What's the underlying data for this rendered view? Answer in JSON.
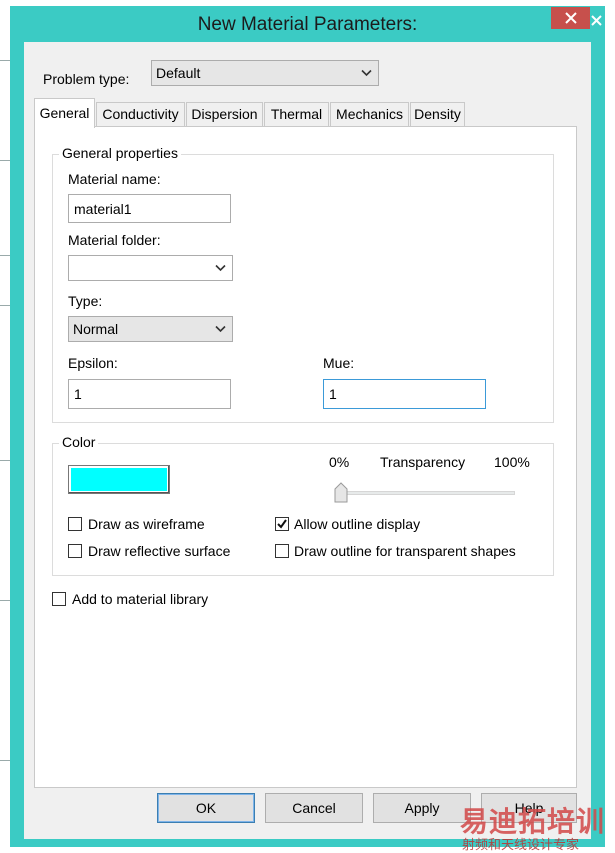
{
  "window": {
    "title": "New Material Parameters:"
  },
  "problem_type": {
    "label": "Problem type:",
    "value": "Default"
  },
  "tabs": [
    {
      "label": "General"
    },
    {
      "label": "Conductivity"
    },
    {
      "label": "Dispersion"
    },
    {
      "label": "Thermal"
    },
    {
      "label": "Mechanics"
    },
    {
      "label": "Density"
    }
  ],
  "general_properties": {
    "title": "General properties",
    "material_name_label": "Material name:",
    "material_name_value": "material1",
    "material_folder_label": "Material folder:",
    "material_folder_value": "",
    "type_label": "Type:",
    "type_value": "Normal",
    "epsilon_label": "Epsilon:",
    "epsilon_value": "1",
    "mue_label": "Mue:",
    "mue_value": "1"
  },
  "color_group": {
    "title": "Color",
    "swatch_color": "#00ffff",
    "transparency_min": "0%",
    "transparency_label": "Transparency",
    "transparency_max": "100%",
    "transparency_value": 0,
    "draw_wireframe_label": "Draw as wireframe",
    "draw_wireframe_checked": false,
    "allow_outline_label": "Allow outline display",
    "allow_outline_checked": true,
    "draw_reflective_label": "Draw reflective surface",
    "draw_reflective_checked": false,
    "draw_outline_transparent_label": "Draw outline for transparent shapes",
    "draw_outline_transparent_checked": false
  },
  "add_to_library": {
    "label": "Add to material library",
    "checked": false
  },
  "buttons": {
    "ok": "OK",
    "cancel": "Cancel",
    "apply": "Apply",
    "help": "Help"
  },
  "colors": {
    "frame": "#3bcbc4",
    "close": "#c7504c",
    "accent_focus": "#3b9ad8"
  },
  "watermark": {
    "line1": "易迪拓培训",
    "line2": "射频和天线设计专家"
  }
}
